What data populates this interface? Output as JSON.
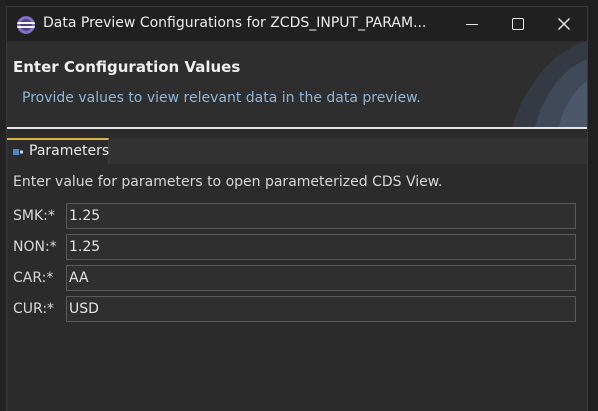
{
  "window": {
    "title": "Data Preview Configurations for ZCDS_INPUT_PARAM...",
    "minimize_icon": "minimize-icon",
    "maximize_icon": "maximize-icon",
    "close_icon": "close-icon"
  },
  "header": {
    "title": "Enter Configuration Values",
    "message": "Provide values to view relevant data in the data preview."
  },
  "tabs": [
    {
      "label": "Parameters",
      "icon": "parameters-icon",
      "active": true,
      "accent": "#d9b24a"
    }
  ],
  "form": {
    "instruction": "Enter value for parameters to open parameterized CDS View.",
    "fields": [
      {
        "label": "SMK:*",
        "value": "1.25"
      },
      {
        "label": "NON:*",
        "value": "1.25"
      },
      {
        "label": "CAR:*",
        "value": "AA"
      },
      {
        "label": "CUR:*",
        "value": "USD"
      }
    ]
  },
  "colors": {
    "message_text": "#8fb6d8",
    "dialog_background": "#2b2b2b",
    "titlebar_background": "#202020"
  }
}
